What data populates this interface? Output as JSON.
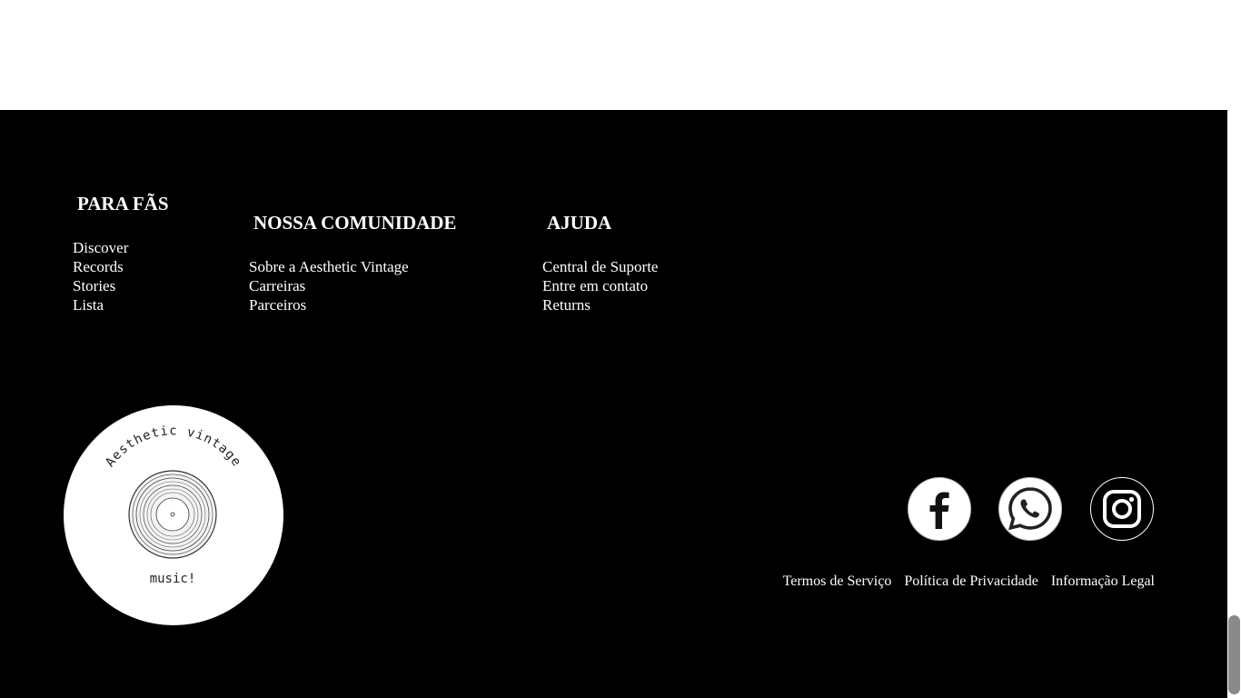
{
  "footer": {
    "columns": [
      {
        "heading": "PARA FÃS",
        "links": [
          "Discover",
          "Records",
          "Stories",
          "Lista"
        ]
      },
      {
        "heading": "NOSSA COMUNIDADE",
        "links": [
          "Sobre a Aesthetic Vintage",
          "Carreiras",
          "Parceiros"
        ]
      },
      {
        "heading": "AJUDA",
        "links": [
          "Central de Suporte",
          "Entre em contato",
          "Returns"
        ]
      }
    ],
    "logo": {
      "top_text": "Aesthetic vintage",
      "bottom_text": "music!"
    },
    "social": [
      {
        "name": "facebook",
        "icon": "facebook-icon"
      },
      {
        "name": "whatsapp",
        "icon": "whatsapp-icon"
      },
      {
        "name": "instagram",
        "icon": "instagram-icon"
      }
    ],
    "legal": [
      "Termos de Serviço",
      "Política de Privacidade",
      "Informação Legal"
    ],
    "colors": {
      "background": "#000000",
      "text": "#ffffff"
    }
  }
}
